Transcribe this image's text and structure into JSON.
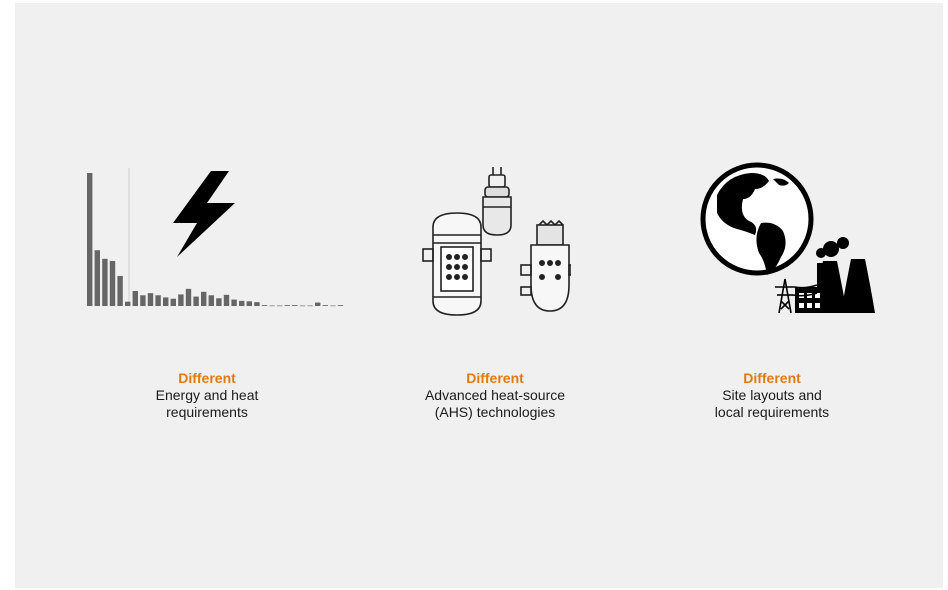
{
  "accent_color": "#e07b12",
  "panels": [
    {
      "icon": "energy-bar-chart-with-lightning-icon",
      "highlight": "Different",
      "line1": "Energy and heat",
      "line2": "requirements"
    },
    {
      "icon": "reactor-vessels-icon",
      "highlight": "Different",
      "line1": "Advanced heat-source",
      "line2": "(AHS) technologies"
    },
    {
      "icon": "globe-and-power-plant-icon",
      "highlight": "Different",
      "line1": "Site layouts and",
      "line2": "local requirements"
    }
  ],
  "chart_data": {
    "type": "bar",
    "values": [
      310,
      130,
      110,
      105,
      70,
      10,
      35,
      25,
      30,
      25,
      20,
      17,
      27,
      40,
      22,
      33,
      25,
      18,
      26,
      15,
      12,
      11,
      9,
      2,
      1,
      1,
      2,
      2,
      1,
      1,
      8,
      2,
      1,
      2
    ]
  }
}
